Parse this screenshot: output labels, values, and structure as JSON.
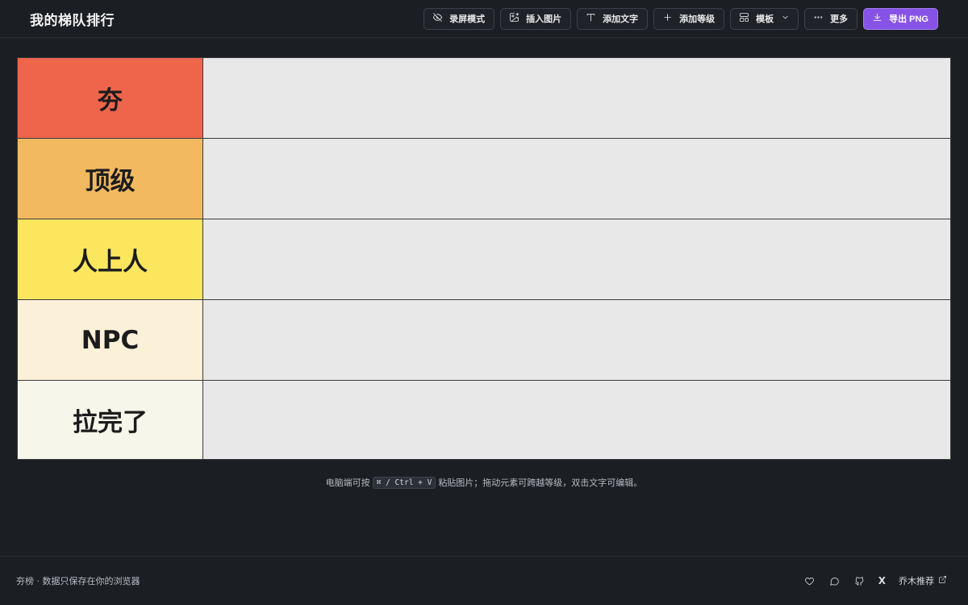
{
  "header": {
    "title": "我的梯队排行",
    "buttons": [
      {
        "label": "录屏模式",
        "icon": "eye-off-icon"
      },
      {
        "label": "插入图片",
        "icon": "image-plus-icon"
      },
      {
        "label": "添加文字",
        "icon": "text-icon"
      },
      {
        "label": "添加等级",
        "icon": "plus-icon"
      },
      {
        "label": "模板",
        "icon": "layout-icon"
      },
      {
        "label": "更多",
        "icon": "more-horizontal-icon"
      },
      {
        "label": "导出 PNG",
        "icon": "download-icon"
      }
    ]
  },
  "tiers": [
    {
      "label": "夯",
      "color": "#ee654c"
    },
    {
      "label": "顶级",
      "color": "#f2b960"
    },
    {
      "label": "人上人",
      "color": "#fbe65e"
    },
    {
      "label": "NPC",
      "color": "#fbf0d8"
    },
    {
      "label": "拉完了",
      "color": "#f7f6ea"
    }
  ],
  "hint": {
    "before": "电脑端可按",
    "shortcut": "⌘ / Ctrl + V",
    "after": "粘贴图片；拖动元素可跨越等级，双击文字可编辑。"
  },
  "footer": {
    "left_text": "夯榜 · 数据只保存在你的浏览器",
    "x_label": "X",
    "recommend_label": "乔木推荐"
  },
  "colors": {
    "background": "#1b1e23",
    "accent": "#8653e6"
  }
}
